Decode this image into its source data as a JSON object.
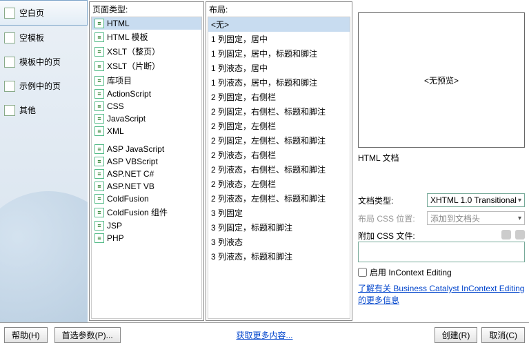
{
  "sidebar": {
    "items": [
      {
        "label": "空白页"
      },
      {
        "label": "空模板"
      },
      {
        "label": "模板中的页"
      },
      {
        "label": "示例中的页"
      },
      {
        "label": "其他"
      }
    ]
  },
  "pageType": {
    "header": "页面类型:",
    "items": [
      "HTML",
      "HTML 模板",
      "XSLT（整页）",
      "XSLT（片断）",
      "库项目",
      "ActionScript",
      "CSS",
      "JavaScript",
      "XML",
      "",
      "ASP JavaScript",
      "ASP VBScript",
      "ASP.NET C#",
      "ASP.NET VB",
      "ColdFusion",
      "ColdFusion 组件",
      "JSP",
      "PHP"
    ]
  },
  "layout": {
    "header": "布局:",
    "items": [
      "<无>",
      "1 列固定，居中",
      "1 列固定，居中，标题和脚注",
      "1 列液态，居中",
      "1 列液态，居中，标题和脚注",
      "2 列固定，右侧栏",
      "2 列固定，右侧栏、标题和脚注",
      "2 列固定，左侧栏",
      "2 列固定，左侧栏、标题和脚注",
      "2 列液态，右侧栏",
      "2 列液态，右侧栏、标题和脚注",
      "2 列液态，左侧栏",
      "2 列液态，左侧栏、标题和脚注",
      "3 列固定",
      "3 列固定，标题和脚注",
      "3 列液态",
      "3 列液态，标题和脚注"
    ]
  },
  "preview": {
    "noPreview": "<无预览>",
    "caption": "HTML 文档"
  },
  "form": {
    "docTypeLabel": "文档类型:",
    "docTypeValue": "XHTML 1.0 Transitional",
    "cssPosLabel": "布局 CSS 位置:",
    "cssPosValue": "添加到文档头",
    "attachLabel": "附加 CSS 文件:",
    "enableIce": "启用 InContext Editing",
    "learnLink": "了解有关 Business Catalyst InContext Editing 的更多信息"
  },
  "footer": {
    "help": "帮助(H)",
    "prefs": "首选参数(P)...",
    "getMore": "获取更多内容...",
    "create": "创建(R)",
    "cancel": "取消(C)"
  }
}
